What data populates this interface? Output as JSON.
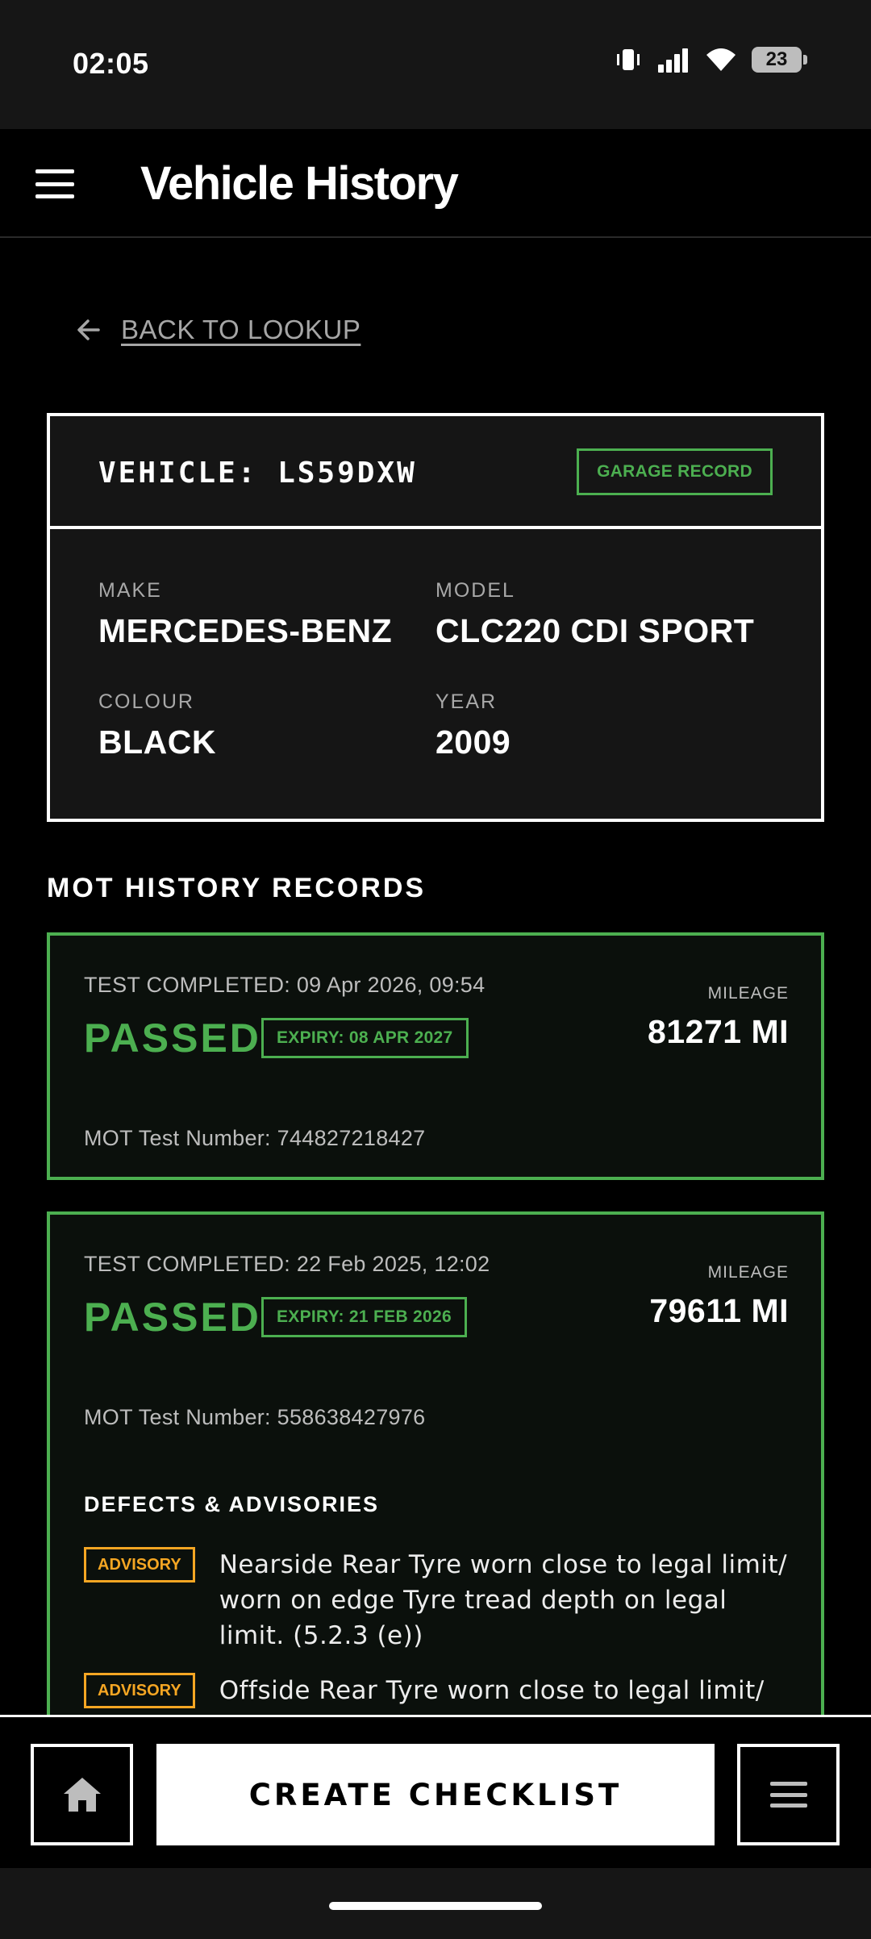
{
  "status_bar": {
    "time": "02:05",
    "battery_level": "23",
    "icons": [
      "vibrate-icon",
      "signal-icon",
      "wifi-icon",
      "battery-icon"
    ]
  },
  "app_bar": {
    "title": "Vehicle History",
    "menu_icon": "hamburger-icon"
  },
  "back_link": {
    "label": "BACK TO LOOKUP",
    "icon": "arrow-left-icon"
  },
  "vehicle": {
    "registration_label": "VEHICLE: LS59DXW",
    "badge": "GARAGE RECORD",
    "fields": {
      "make": {
        "label": "MAKE",
        "value": "MERCEDES-BENZ"
      },
      "model": {
        "label": "MODEL",
        "value": "CLC220 CDI SPORT"
      },
      "colour": {
        "label": "COLOUR",
        "value": "BLACK"
      },
      "year": {
        "label": "YEAR",
        "value": "2009"
      }
    }
  },
  "mot_section": {
    "title": "MOT HISTORY RECORDS",
    "records": [
      {
        "test_completed": "TEST COMPLETED: 09 Apr 2026, 09:54",
        "status": "PASSED",
        "expiry": "EXPIRY: 08 APR 2027",
        "mileage_label": "MILEAGE",
        "mileage": "81271 MI",
        "test_number": "MOT Test Number: 744827218427"
      },
      {
        "test_completed": "TEST COMPLETED: 22 Feb 2025, 12:02",
        "status": "PASSED",
        "expiry": "EXPIRY: 21 FEB 2026",
        "mileage_label": "MILEAGE",
        "mileage": "79611 MI",
        "test_number": "MOT Test Number: 558638427976",
        "defects_title": "DEFECTS & ADVISORIES",
        "defects": [
          {
            "type": "ADVISORY",
            "text": "Nearside Rear Tyre worn close to legal limit/ worn on edge Tyre tread depth on legal limit. (5.2.3 (e))"
          },
          {
            "type": "ADVISORY",
            "text": "Offside Rear Tyre worn close to legal limit/"
          }
        ]
      }
    ]
  },
  "bottom_bar": {
    "home_icon": "home-icon",
    "primary_action": "CREATE CHECKLIST",
    "menu_icon": "menu-icon"
  },
  "colors": {
    "accent_green": "#4caf50",
    "advisory_orange": "#f5a623",
    "background": "#000000"
  }
}
